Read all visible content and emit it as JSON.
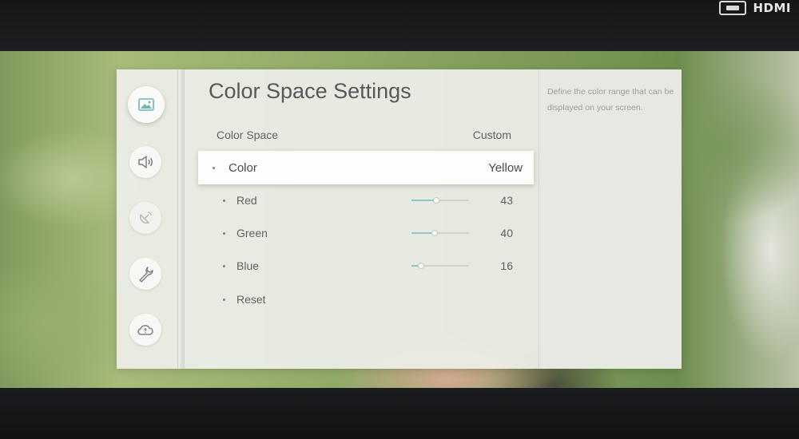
{
  "input_source": {
    "label": "HDMI",
    "icon": "hdmi-port-icon"
  },
  "sidebar": {
    "items": [
      {
        "name": "picture",
        "icon": "picture-icon",
        "active": true
      },
      {
        "name": "sound",
        "icon": "speaker-icon",
        "active": false
      },
      {
        "name": "broadcasting",
        "icon": "satellite-dish-icon",
        "active": false
      },
      {
        "name": "general",
        "icon": "wrench-icon",
        "active": false
      },
      {
        "name": "support",
        "icon": "cloud-help-icon",
        "active": false
      }
    ]
  },
  "panel": {
    "title": "Color Space Settings",
    "header_row": {
      "label": "Color Space",
      "value": "Custom"
    },
    "color_row": {
      "label": "Color",
      "value": "Yellow"
    },
    "channels": [
      {
        "label": "Red",
        "value": "43",
        "level": 43
      },
      {
        "label": "Green",
        "value": "40",
        "level": 40
      },
      {
        "label": "Blue",
        "value": "16",
        "level": 16
      }
    ],
    "reset_label": "Reset"
  },
  "help": {
    "text": "Define the color range that can be displayed on your screen."
  },
  "colors": {
    "accent": "#8fc7c6",
    "panel": "#eeefe9",
    "text": "#5f6367"
  }
}
